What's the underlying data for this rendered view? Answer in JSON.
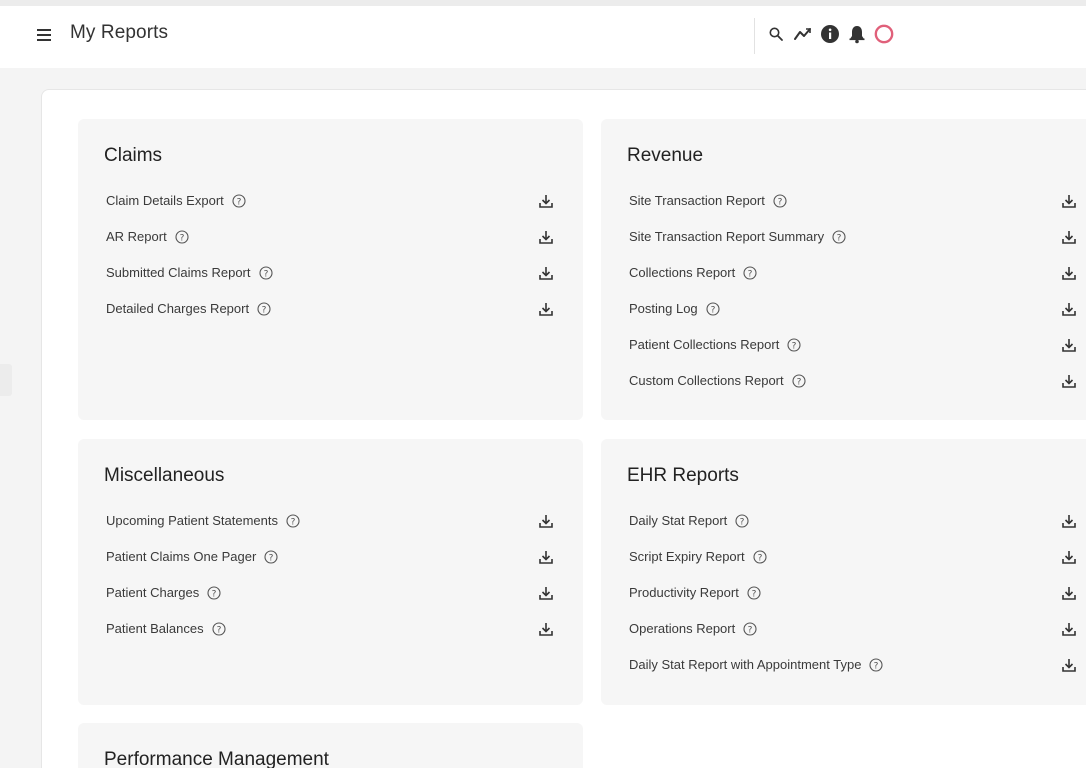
{
  "header": {
    "title": "My Reports",
    "icons": [
      "menu-icon",
      "search-icon",
      "trend-icon",
      "info-icon",
      "bell-icon",
      "status-ring-icon"
    ]
  },
  "colors": {
    "accent_ring": "#e0607a",
    "card_bg": "#f6f6f6",
    "text": "#3a3a3a"
  },
  "cards": {
    "claims": {
      "title": "Claims",
      "reports": [
        "Claim Details Export",
        "AR Report",
        "Submitted Claims Report",
        "Detailed Charges Report"
      ]
    },
    "revenue": {
      "title": "Revenue",
      "reports": [
        "Site Transaction Report",
        "Site Transaction Report Summary",
        "Collections Report",
        "Posting Log",
        "Patient Collections Report",
        "Custom Collections Report"
      ]
    },
    "misc": {
      "title": "Miscellaneous",
      "reports": [
        "Upcoming Patient Statements",
        "Patient Claims One Pager",
        "Patient Charges",
        "Patient Balances"
      ]
    },
    "ehr": {
      "title": "EHR Reports",
      "reports": [
        "Daily Stat Report",
        "Script Expiry Report",
        "Productivity Report",
        "Operations Report",
        "Daily Stat Report with Appointment Type"
      ]
    },
    "perf": {
      "title": "Performance Management",
      "reports": []
    }
  }
}
